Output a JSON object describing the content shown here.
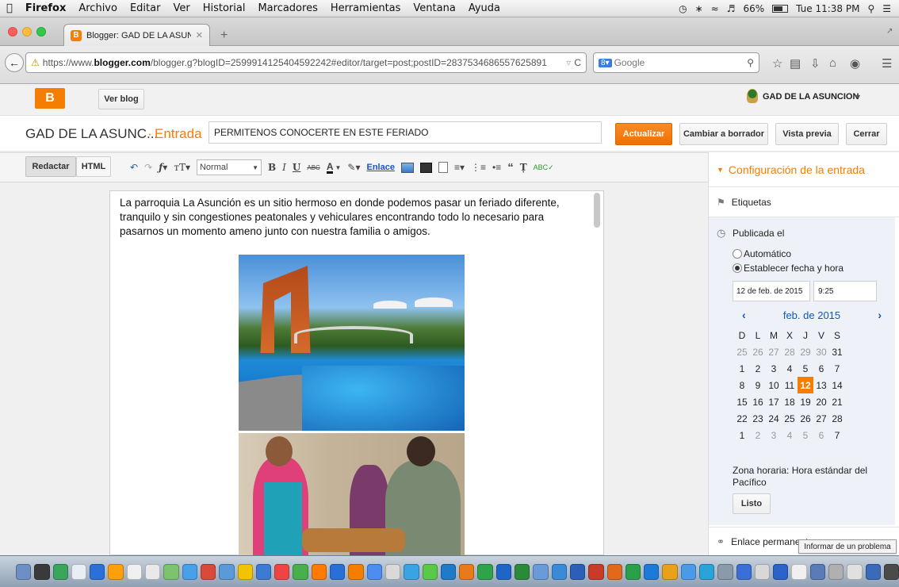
{
  "menubar": {
    "app": "Firefox",
    "items": [
      "Archivo",
      "Editar",
      "Ver",
      "Historial",
      "Marcadores",
      "Herramientas",
      "Ventana",
      "Ayuda"
    ],
    "battery": "66%",
    "clock": "Tue 11:38 PM"
  },
  "browser": {
    "tab_title": "Blogger: GAD DE LA ASUN...",
    "url_prefix": "https://www.",
    "url_domain": "blogger.com",
    "url_rest": "/blogger.g?blogID=2599914125404592242#editor/target=post;postID=2837534686557625891",
    "search_placeholder": "Google"
  },
  "blogger": {
    "view_blog": "Ver blog",
    "blog_name": "GAD DE LA ASUNCION",
    "title_short": "GAD DE LA ASUNC...",
    "separator": "·",
    "section": "Entrada",
    "post_title": "PERMITENOS CONOCERTE EN ESTE FERIADO",
    "update": "Actualizar",
    "draft": "Cambiar a borrador",
    "preview": "Vista previa",
    "close": "Cerrar"
  },
  "toolbar": {
    "compose": "Redactar",
    "html": "HTML",
    "font_style": "Normal",
    "link": "Enlace"
  },
  "editor": {
    "body": "La parroquia La Asunción es un sitio hermoso en donde  podemos pasar un feriado diferente, tranquilo y sin congestiones peatonales y vehiculares encontrando todo lo necesario para pasarnos un momento ameno junto con nuestra familia o amigos."
  },
  "sidebar": {
    "header": "Configuración de la entrada",
    "labels": "Etiquetas",
    "published": "Publicada el",
    "automatic": "Automático",
    "set_date": "Establecer fecha y hora",
    "date_value": "12 de feb. de 2015",
    "time_value": "9:25",
    "cal_prev": "‹",
    "cal_next": "›",
    "cal_month": "feb. de 2015",
    "weekdays": [
      "D",
      "L",
      "M",
      "X",
      "J",
      "V",
      "S"
    ],
    "weeks": [
      [
        [
          "25",
          true
        ],
        [
          "26",
          true
        ],
        [
          "27",
          true
        ],
        [
          "28",
          true
        ],
        [
          "29",
          true
        ],
        [
          "30",
          true
        ],
        [
          "31",
          false
        ]
      ],
      [
        [
          "1",
          false
        ],
        [
          "2",
          false
        ],
        [
          "3",
          false
        ],
        [
          "4",
          false
        ],
        [
          "5",
          false
        ],
        [
          "6",
          false
        ],
        [
          "7",
          false
        ]
      ],
      [
        [
          "8",
          false
        ],
        [
          "9",
          false
        ],
        [
          "10",
          false
        ],
        [
          "11",
          false
        ],
        [
          "12",
          false
        ],
        [
          "13",
          false
        ],
        [
          "14",
          false
        ]
      ],
      [
        [
          "15",
          false
        ],
        [
          "16",
          false
        ],
        [
          "17",
          false
        ],
        [
          "18",
          false
        ],
        [
          "19",
          false
        ],
        [
          "20",
          false
        ],
        [
          "21",
          false
        ]
      ],
      [
        [
          "22",
          false
        ],
        [
          "23",
          false
        ],
        [
          "24",
          false
        ],
        [
          "25",
          false
        ],
        [
          "26",
          false
        ],
        [
          "27",
          false
        ],
        [
          "28",
          false
        ]
      ],
      [
        [
          "1",
          false
        ],
        [
          "2",
          true
        ],
        [
          "3",
          true
        ],
        [
          "4",
          true
        ],
        [
          "5",
          true
        ],
        [
          "6",
          true
        ],
        [
          "7",
          false
        ]
      ]
    ],
    "selected_day": "12",
    "timezone": "Zona horaria: Hora estándar del Pacífico",
    "done": "Listo",
    "permalink": "Enlace permanente",
    "report": "Informar de un problema"
  },
  "colors": {
    "accent": "#f57d00",
    "link_blue": "#1155cc"
  }
}
